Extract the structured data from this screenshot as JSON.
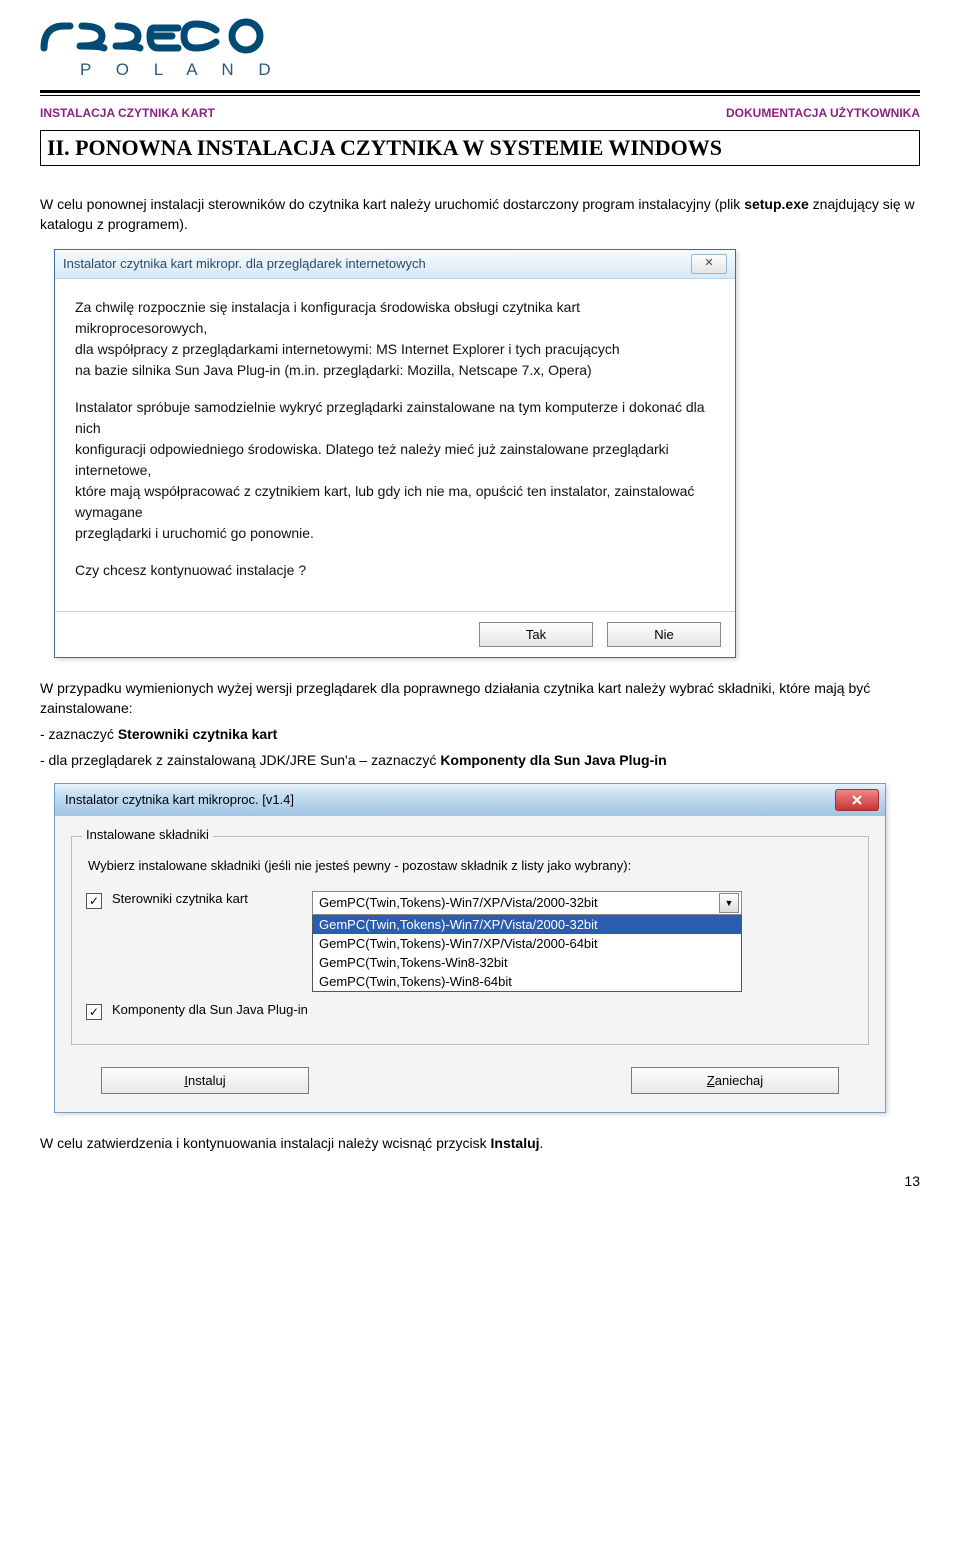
{
  "header": {
    "logo_sub": "P O L A N D",
    "left": "INSTALACJA CZYTNIKA KART",
    "right": "DOKUMENTACJA  UŻYTKOWNIKA"
  },
  "section_title": "II. PONOWNA INSTALACJA CZYTNIKA W SYSTEMIE WINDOWS",
  "para1_a": "W celu ponownej instalacji sterowników do czytnika kart należy uruchomić dostarczony program instalacyjny (plik ",
  "para1_b": "setup.exe",
  "para1_c": " znajdujący się w katalogu z programem).",
  "dialog1": {
    "title": "Instalator czytnika kart mikropr. dla przeglądarek internetowych",
    "p1": "Za chwilę rozpocznie się instalacja i konfiguracja środowiska obsługi czytnika kart mikroprocesorowych,",
    "p2": "dla współpracy z przeglądarkami internetowymi: MS Internet Explorer i tych pracujących",
    "p3": "na bazie silnika Sun Java Plug-in (m.in. przeglądarki: Mozilla, Netscape 7.x, Opera)",
    "p4": "Instalator spróbuje samodzielnie wykryć przeglądarki zainstalowane na tym komputerze i dokonać dla nich",
    "p5": "konfiguracji odpowiedniego środowiska. Dlatego też należy mieć już zainstalowane przeglądarki internetowe,",
    "p6": "które mają współpracować z czytnikiem kart, lub gdy ich nie ma, opuścić ten instalator, zainstalować wymagane",
    "p7": "przeglądarki i uruchomić go ponownie.",
    "p8": "Czy chcesz kontynuować instalacje ?",
    "yes": "Tak",
    "no": "Nie"
  },
  "para2": "W przypadku wymienionych wyżej wersji przeglądarek dla poprawnego działania czytnika kart należy wybrać składniki, które mają być zainstalowane:",
  "bullet1_a": "- zaznaczyć ",
  "bullet1_b": "Sterowniki czytnika kart",
  "bullet2_a": "- dla przeglądarek z zainstalowaną JDK/JRE Sun'a – zaznaczyć ",
  "bullet2_b": "Komponenty dla Sun  Java Plug-in",
  "dialog2": {
    "title": "Instalator czytnika kart mikroproc. [v1.4]",
    "group_legend": "Instalowane składniki",
    "group_text": "Wybierz instalowane składniki (jeśli nie jesteś pewny - pozostaw składnik z listy jako wybrany):",
    "cb1_label": "Sterowniki czytnika kart",
    "combo_value": "GemPC(Twin,Tokens)-Win7/XP/Vista/2000-32bit",
    "options": [
      "GemPC(Twin,Tokens)-Win7/XP/Vista/2000-32bit",
      "GemPC(Twin,Tokens)-Win7/XP/Vista/2000-64bit",
      "GemPC(Twin,Tokens-Win8-32bit",
      "GemPC(Twin,Tokens)-Win8-64bit"
    ],
    "cb2_label": "Komponenty dla Sun Java Plug-in",
    "install_u": "I",
    "install_rest": "nstaluj",
    "cancel_u": "Z",
    "cancel_rest": "aniechaj"
  },
  "para3_a": "W celu zatwierdzenia i kontynuowania instalacji należy wcisnąć przycisk ",
  "para3_b": "Instaluj",
  "para3_c": ".",
  "page_number": "13"
}
